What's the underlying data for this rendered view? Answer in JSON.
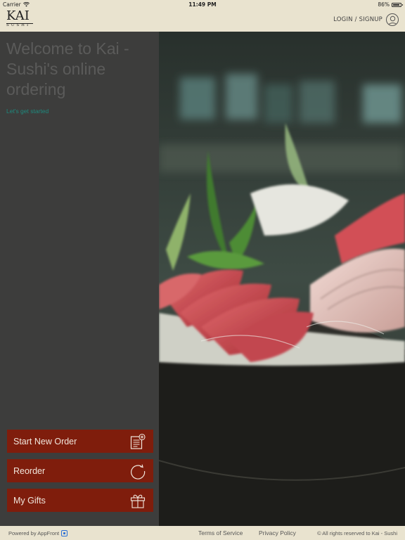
{
  "status_bar": {
    "carrier": "Carrier",
    "time": "11:49 PM",
    "battery": "86%",
    "battery_level": 0.86
  },
  "header": {
    "logo_main": "KAI",
    "logo_sub": "SUSHI",
    "login_label": "LOGIN / SIGNUP"
  },
  "panel": {
    "welcome": "Welcome to Kai - Sushi's online ordering",
    "get_started": "Let's get started",
    "buttons": [
      {
        "label": "Start New Order",
        "icon": "new-order-icon"
      },
      {
        "label": "Reorder",
        "icon": "refresh-icon"
      },
      {
        "label": "My Gifts",
        "icon": "gift-icon"
      }
    ]
  },
  "footer": {
    "powered_by": "Powered by AppFront",
    "terms": "Terms of Service",
    "privacy": "Privacy Policy",
    "rights": "© All rights reserved to Kai - Sushi"
  },
  "colors": {
    "background": "#e9e3cf",
    "panel": "#3d3d3c",
    "button": "#7f1d0c",
    "accent_link": "#1e8a7e"
  }
}
